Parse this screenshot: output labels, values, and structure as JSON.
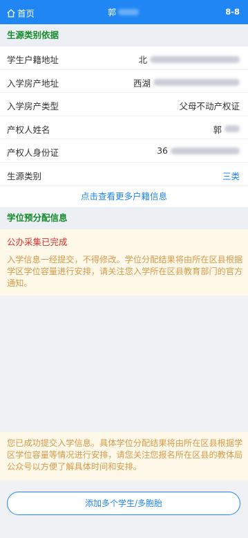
{
  "header": {
    "home_label": "首页",
    "title_visible_char": "郭",
    "range": "8-8"
  },
  "section1": {
    "title": "生源类别依据",
    "rows": [
      {
        "label": "学生户籍地址",
        "value_prefix": "北"
      },
      {
        "label": "入学房产地址",
        "value_prefix": "西湖"
      },
      {
        "label": "入学房产类型",
        "value": "父母不动产权证"
      },
      {
        "label": "产权人姓名",
        "value_prefix": "郭"
      },
      {
        "label": "产权人身份证",
        "value_prefix": "36"
      },
      {
        "label": "生源类别",
        "value": "三类"
      }
    ],
    "more_link": "点击查看更多户籍信息"
  },
  "section2": {
    "title": "学位预分配信息",
    "status": "公办采集已完成",
    "notice": "入学信息一经提交，不得修改。学位分配结果将由所在区县根据学区学位容量进行安排，请关注您入学所在区县教育部门的官方通知。"
  },
  "footer": {
    "notice": "您已成功提交入学信息。具体学位分配结果将由所在区县根据学区学位容量等情况进行安排，请您关注您报名所在区县的教体局公众号以方便了解具体时间和安排。",
    "add_button": "添加多个学生/多胞胎"
  },
  "colors": {
    "primary": "#1f86f4",
    "section_title": "#14892a",
    "notice_bg": "#fdf8e8",
    "notice_text": "#d49a4a",
    "status_red": "#d32f2f"
  }
}
